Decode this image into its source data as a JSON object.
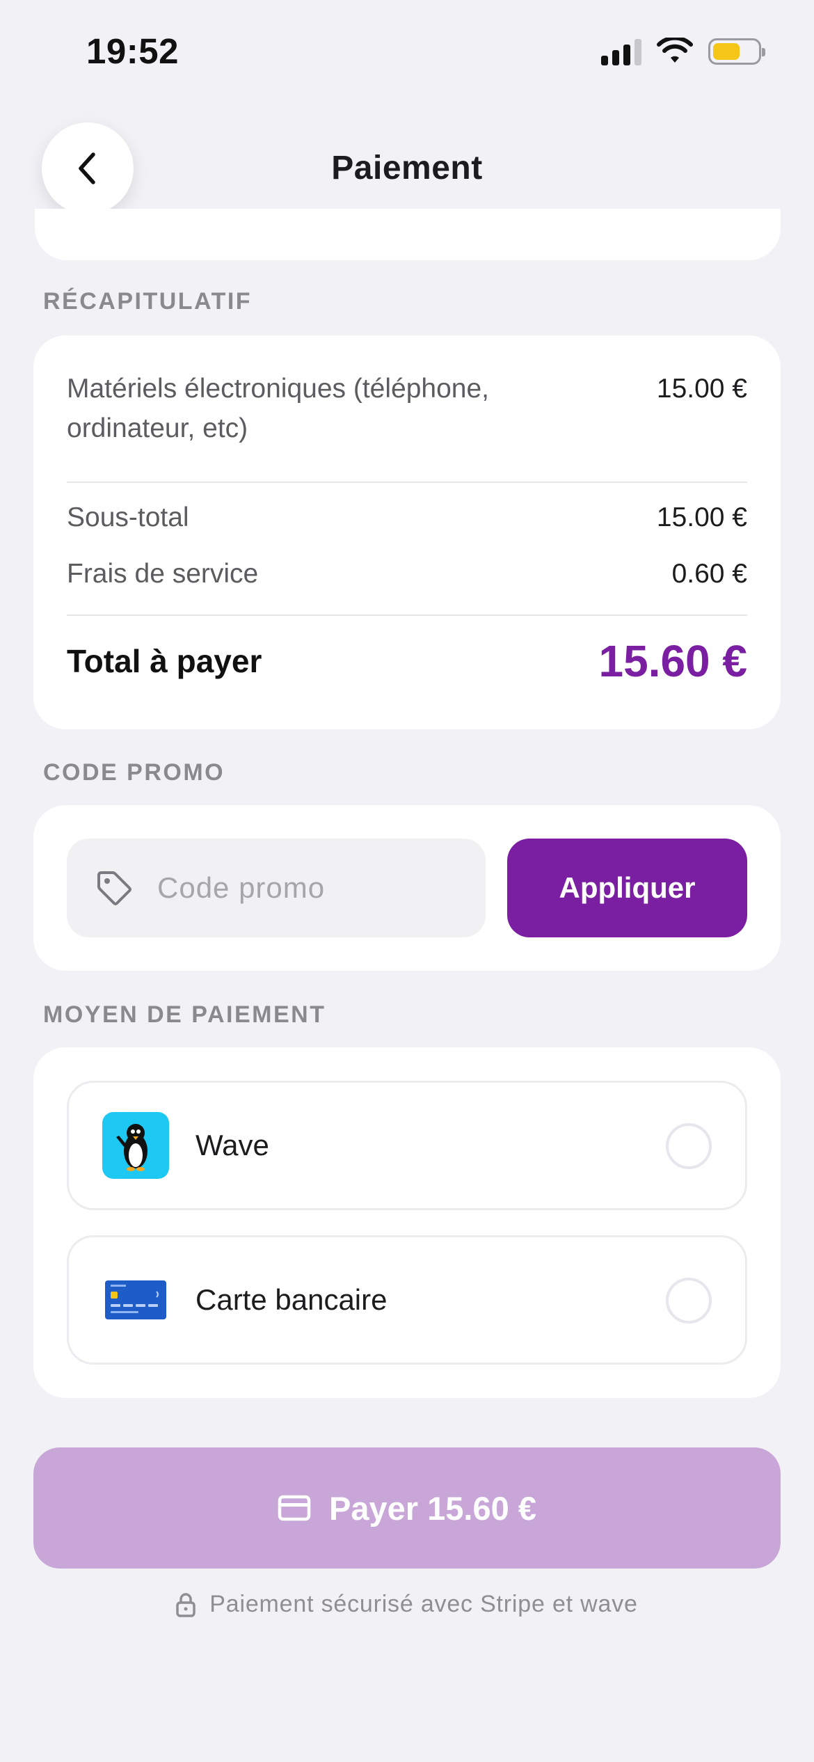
{
  "status_bar": {
    "time": "19:52",
    "battery_level": 0.62,
    "battery_color": "#f5c518"
  },
  "header": {
    "title": "Paiement",
    "back_icon": "chevron-left-icon"
  },
  "summary": {
    "section_label": "RÉCAPITULATIF",
    "item_label": "Matériels électroniques (téléphone, ordinateur, etc)",
    "item_amount": "15.00 €",
    "subtotal_label": "Sous-total",
    "subtotal_amount": "15.00 €",
    "fee_label": "Frais de service",
    "fee_amount": "0.60 €",
    "total_label": "Total à payer",
    "total_amount": "15.60 €"
  },
  "promo": {
    "section_label": "CODE PROMO",
    "placeholder": "Code promo",
    "value": "",
    "apply_label": "Appliquer",
    "icon": "tag-icon"
  },
  "payment": {
    "section_label": "MOYEN DE PAIEMENT",
    "methods": [
      {
        "name": "Wave",
        "icon": "wave-penguin-icon",
        "selected": false
      },
      {
        "name": "Carte bancaire",
        "icon": "credit-card-icon",
        "selected": false
      }
    ]
  },
  "pay_button": {
    "label": "Payer 15.60 €",
    "icon": "card-icon"
  },
  "secure_note": {
    "text": "Paiement sécurisé avec Stripe et wave",
    "icon": "lock-icon"
  },
  "colors": {
    "accent": "#7b1fa2",
    "accent_disabled": "#c8a6d8",
    "background": "#f1f1f6",
    "wave_blue": "#1dc8f2"
  }
}
